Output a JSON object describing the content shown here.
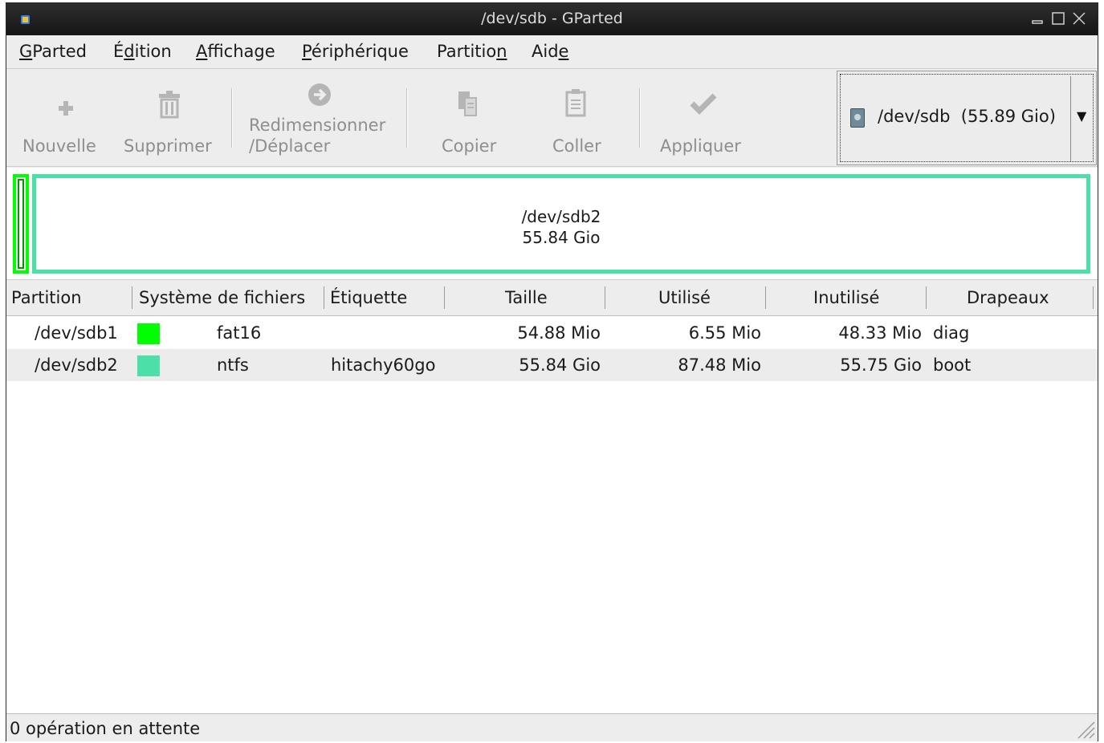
{
  "window": {
    "title": "/dev/sdb - GParted"
  },
  "menu": {
    "gparted": {
      "pre": "",
      "mnemonic": "G",
      "post": "Parted"
    },
    "edition": {
      "pre": "É",
      "mnemonic": "d",
      "post": "ition"
    },
    "affichage": {
      "pre": "",
      "mnemonic": "A",
      "post": "ffichage"
    },
    "peripherique": {
      "pre": "",
      "mnemonic": "P",
      "post": "ériphérique"
    },
    "partition": {
      "pre": "Partitio",
      "mnemonic": "n",
      "post": ""
    },
    "aide": {
      "pre": "Aid",
      "mnemonic": "e",
      "post": ""
    }
  },
  "toolbar": {
    "new_label": "Nouvelle",
    "delete_label": "Supprimer",
    "resize_label_1": "Redimensionner",
    "resize_label_2": "/Déplacer",
    "copy_label": "Copier",
    "paste_label": "Coller",
    "apply_label": "Appliquer"
  },
  "device": {
    "name": "/dev/sdb",
    "size": "(55.89 Gio)"
  },
  "diskmap": {
    "partition_name": "/dev/sdb2",
    "partition_size": "55.84 Gio"
  },
  "table": {
    "headers": {
      "partition": "Partition",
      "filesystem": "Système de fichiers",
      "label": "Étiquette",
      "size": "Taille",
      "used": "Utilisé",
      "unused": "Inutilisé",
      "flags": "Drapeaux"
    },
    "rows": [
      {
        "partition": "/dev/sdb1",
        "color": "#00ff00",
        "filesystem": "fat16",
        "label": "",
        "size": "54.88 Mio",
        "used": "6.55 Mio",
        "unused": "48.33 Mio",
        "flags": "diag"
      },
      {
        "partition": "/dev/sdb2",
        "color": "#4ce0a8",
        "filesystem": "ntfs",
        "label": "hitachy60go",
        "size": "55.84 Gio",
        "used": "87.48 Mio",
        "unused": "55.75 Gio",
        "flags": "boot"
      }
    ]
  },
  "status": {
    "text": "0 opération en attente"
  }
}
